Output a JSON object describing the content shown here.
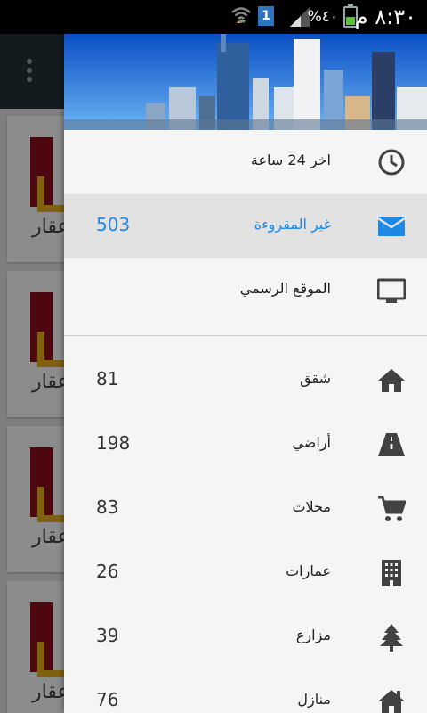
{
  "status_bar": {
    "time": "٨:٣٠ م",
    "battery_percent": "%٤٠",
    "sim_slot": "1",
    "colors": {
      "battery_fill": "#5bc236",
      "sim_badge": "#2f74c0"
    }
  },
  "background_app": {
    "card_text": "عقار",
    "overflow_icon": "more-vert-icon"
  },
  "drawer": {
    "accent_color": "#1e88e5",
    "top_items": [
      {
        "label": "اخر 24 ساعة",
        "icon": "clock-icon",
        "count": ""
      },
      {
        "label": "غير المقروءة",
        "icon": "mail-icon",
        "count": "503",
        "selected": true
      },
      {
        "label": "الموقع الرسمي",
        "icon": "monitor-icon",
        "count": ""
      }
    ],
    "categories": [
      {
        "label": "شقق",
        "icon": "home-icon",
        "count": "81"
      },
      {
        "label": "أراضي",
        "icon": "road-icon",
        "count": "198"
      },
      {
        "label": "محلات",
        "icon": "cart-icon",
        "count": "83"
      },
      {
        "label": "عمارات",
        "icon": "building-icon",
        "count": "26"
      },
      {
        "label": "مزارع",
        "icon": "tree-icon",
        "count": "39"
      },
      {
        "label": "منازل",
        "icon": "house-icon",
        "count": "76"
      }
    ]
  }
}
